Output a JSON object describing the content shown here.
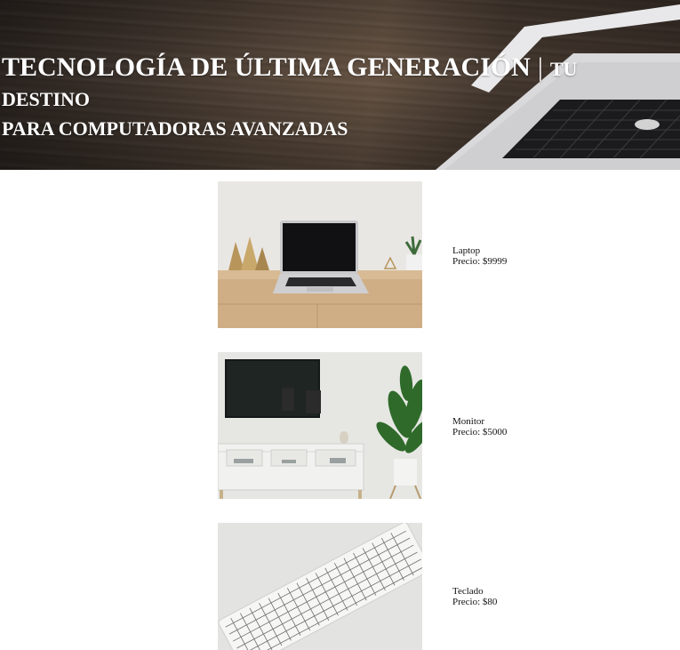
{
  "header": {
    "title_main": "TECNOLOGÍA DE ÚLTIMA GENERACIÓN",
    "separator": "|",
    "title_sub_line1": "TU DESTINO",
    "title_sub_line2": "PARA COMPUTADORAS AVANZADAS",
    "background_image": "laptop-on-wooden-desk"
  },
  "products": [
    {
      "name": "Laptop",
      "price": "Precio: $9999",
      "image": "laptop-on-desk-photo"
    },
    {
      "name": "Monitor",
      "price": "Precio: $5000",
      "image": "tv-monitor-living-room-photo"
    },
    {
      "name": "Teclado",
      "price": "Precio: $80",
      "image": "white-keyboard-photo"
    }
  ],
  "colors": {
    "header_text": "#ffffff",
    "body_text": "#111111",
    "page_background": "#ffffff"
  }
}
